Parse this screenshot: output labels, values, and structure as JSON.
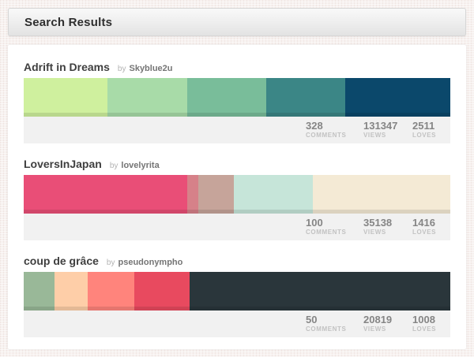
{
  "header": {
    "title": "Search Results"
  },
  "stat_labels": {
    "comments": "COMMENTS",
    "views": "VIEWS",
    "loves": "LOVES"
  },
  "palettes": [
    {
      "title": "Adrift in Dreams",
      "by": "by",
      "author": "Skyblue2u",
      "colors": [
        {
          "hex": "#CFF09E",
          "width_pct": 19.6
        },
        {
          "hex": "#A8DBA8",
          "width_pct": 18.7
        },
        {
          "hex": "#79BD9A",
          "width_pct": 18.5
        },
        {
          "hex": "#3B8686",
          "width_pct": 18.6
        },
        {
          "hex": "#0B486B",
          "width_pct": 24.6
        }
      ],
      "stats": {
        "comments": "328",
        "views": "131347",
        "loves": "2511"
      }
    },
    {
      "title": "LoversInJapan",
      "by": "by",
      "author": "lovelyrita",
      "colors": [
        {
          "hex": "#E94E77",
          "width_pct": 38.3
        },
        {
          "hex": "#D68189",
          "width_pct": 2.6
        },
        {
          "hex": "#C6A49A",
          "width_pct": 8.3
        },
        {
          "hex": "#C6E5D9",
          "width_pct": 18.6
        },
        {
          "hex": "#F4EAD5",
          "width_pct": 32.2
        }
      ],
      "stats": {
        "comments": "100",
        "views": "35138",
        "loves": "1416"
      }
    },
    {
      "title": "coup de grâce",
      "by": "by",
      "author": "pseudonympho",
      "colors": [
        {
          "hex": "#99B898",
          "width_pct": 7.3
        },
        {
          "hex": "#FECEA8",
          "width_pct": 7.7
        },
        {
          "hex": "#FF847C",
          "width_pct": 11.0
        },
        {
          "hex": "#E84A5F",
          "width_pct": 12.9
        },
        {
          "hex": "#2A363B",
          "width_pct": 61.1
        }
      ],
      "stats": {
        "comments": "50",
        "views": "20819",
        "loves": "1008"
      }
    }
  ]
}
